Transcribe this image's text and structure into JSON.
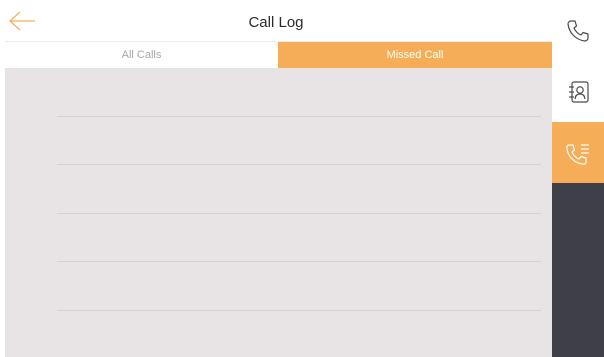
{
  "header": {
    "title": "Call Log",
    "back_icon": "arrow-left-icon"
  },
  "tabs": [
    {
      "label": "All Calls",
      "selected": false
    },
    {
      "label": "Missed Call",
      "selected": true
    }
  ],
  "call_list": {
    "items": []
  },
  "rail": {
    "items": [
      {
        "icon": "phone-icon",
        "active": false
      },
      {
        "icon": "contacts-book-icon",
        "active": false
      },
      {
        "icon": "call-log-icon",
        "active": true
      }
    ]
  },
  "colors": {
    "accent": "#f5ae57",
    "rail_bg": "#3f4047",
    "list_bg": "#e8e4e6",
    "tab_inactive_text": "#a7a7a7",
    "title_text": "#2b2b2b"
  }
}
